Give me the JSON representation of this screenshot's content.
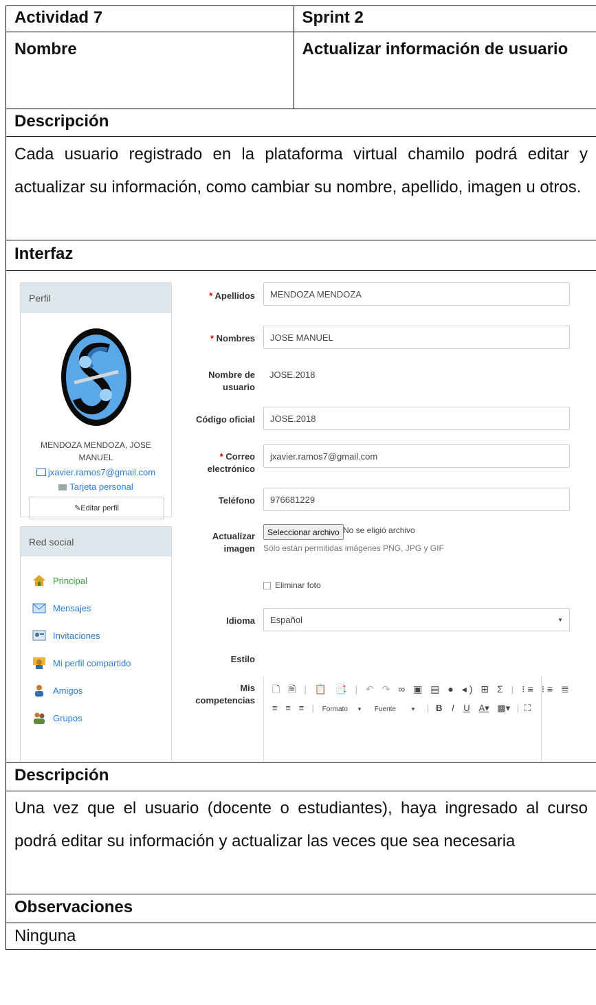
{
  "table": {
    "activity_label": "Actividad 7",
    "sprint_label": "Sprint 2",
    "name_label": "Nombre",
    "name_value": "Actualizar información de usuario",
    "desc_label_1": "Descripción",
    "desc_text_1": "Cada usuario registrado en la plataforma virtual chamilo podrá editar y actualizar su información, como cambiar su nombre, apellido, imagen u otros.",
    "interface_label": "Interfaz",
    "desc_label_2": "Descripción",
    "desc_text_2": "Una vez que el usuario (docente  o estudiantes), haya ingresado al curso podrá editar su información y actualizar las veces que sea necesaria",
    "obs_label": "Observaciones",
    "obs_value": "Ninguna"
  },
  "profile": {
    "header": "Perfil",
    "full_name": "MENDOZA MENDOZA, JOSE MANUEL",
    "email": "jxavier.ramos7@gmail.com",
    "card": "Tarjeta personal",
    "edit_button": "Editar perfil"
  },
  "social": {
    "header": "Red social",
    "items": [
      "Principal",
      "Mensajes",
      "Invitaciones",
      "Mi perfil compartido",
      "Amigos",
      "Grupos"
    ]
  },
  "form": {
    "apellidos_label": "Apellidos",
    "apellidos_value": "MENDOZA MENDOZA",
    "nombres_label": "Nombres",
    "nombres_value": "JOSE MANUEL",
    "username_label_1": "Nombre de",
    "username_label_2": "usuario",
    "username_value": "JOSE.2018",
    "code_label": "Código oficial",
    "code_value": "JOSE.2018",
    "email_label_1": "Correo",
    "email_label_2": "electrónico",
    "email_value": "jxavier.ramos7@gmail.com",
    "phone_label": "Teléfono",
    "phone_value": "976681229",
    "image_label_1": "Actualizar",
    "image_label_2": "imagen",
    "file_button": "Seleccionar archivo",
    "file_status": "No se eligió archivo",
    "file_help": "Sólo están permitidas imágenes PNG, JPG y GIF",
    "delete_photo": "Eliminar foto",
    "language_label": "Idioma",
    "language_value": "Español",
    "style_label": "Estilo",
    "skills_label_1": "Mis",
    "skills_label_2": "competencias",
    "editor_format": "Formato",
    "editor_font": "Fuente"
  },
  "colors": {
    "link": "#2a7bd1",
    "panel_head": "#dde6ea",
    "required": "#dd0000"
  }
}
